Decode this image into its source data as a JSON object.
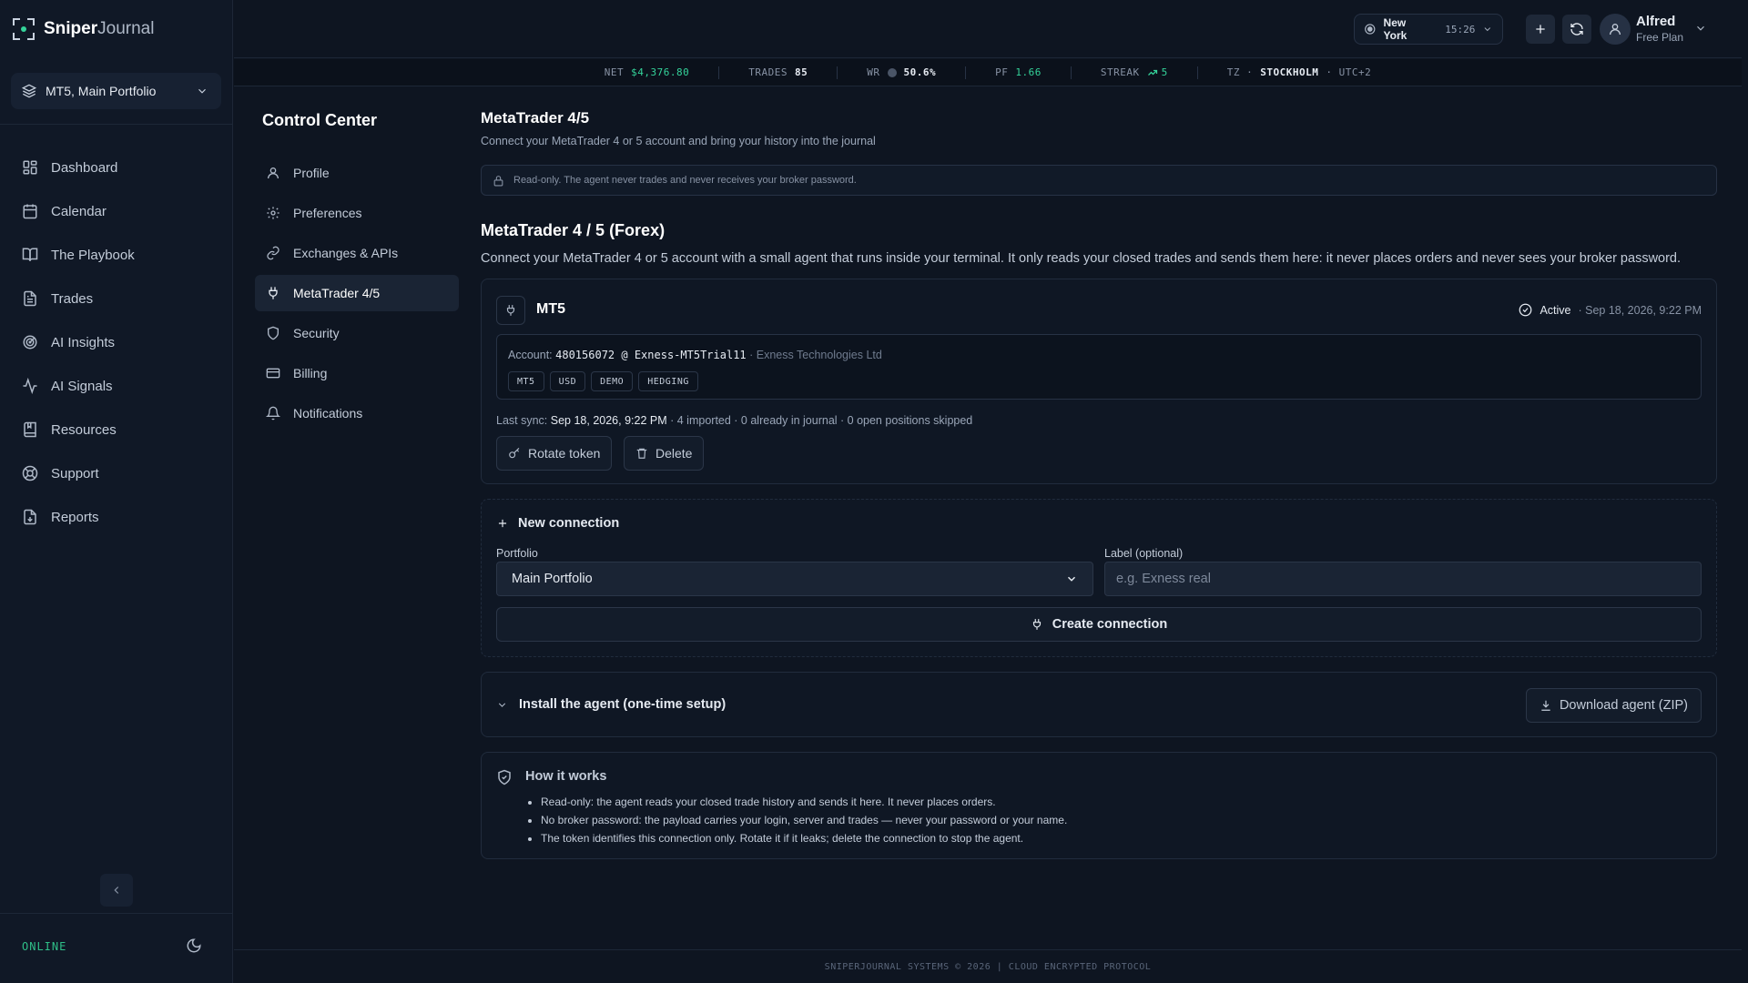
{
  "app": {
    "name_bold": "Sniper",
    "name_light": "Journal"
  },
  "sidebar": {
    "portfolio": "MT5, Main Portfolio",
    "items": [
      {
        "label": "Dashboard",
        "icon": "grid-icon"
      },
      {
        "label": "Calendar",
        "icon": "calendar-icon"
      },
      {
        "label": "The Playbook",
        "icon": "book-icon"
      },
      {
        "label": "Trades",
        "icon": "document-icon"
      },
      {
        "label": "AI Insights",
        "icon": "radar-icon"
      },
      {
        "label": "AI Signals",
        "icon": "pulse-icon"
      },
      {
        "label": "Resources",
        "icon": "bookmark-book-icon"
      },
      {
        "label": "Support",
        "icon": "lifebuoy-icon"
      },
      {
        "label": "Reports",
        "icon": "file-download-icon"
      }
    ],
    "status": "ONLINE"
  },
  "topbar": {
    "city": "New York",
    "time": "15:26",
    "user": {
      "name": "Alfred",
      "plan": "Free Plan"
    }
  },
  "stats": {
    "net_label": "NET",
    "net_value": "$4,376.80",
    "trades_label": "TRADES",
    "trades_value": "85",
    "wr_label": "WR",
    "wr_value": "50.6%",
    "pf_label": "PF",
    "pf_value": "1.66",
    "streak_label": "STREAK",
    "streak_value": "5",
    "tz_label": "TZ ·",
    "tz_city": "STOCKHOLM",
    "tz_offset": "· UTC+2"
  },
  "control_center": {
    "title": "Control Center",
    "items": [
      {
        "label": "Profile"
      },
      {
        "label": "Preferences"
      },
      {
        "label": "Exchanges & APIs"
      },
      {
        "label": "MetaTrader 4/5"
      },
      {
        "label": "Security"
      },
      {
        "label": "Billing"
      },
      {
        "label": "Notifications"
      }
    ]
  },
  "page": {
    "title": "MetaTrader 4/5",
    "subtitle": "Connect your MetaTrader 4 or 5 account and bring your history into the journal",
    "notice": "Read-only. The agent never trades and never receives your broker password.",
    "section_title": "MetaTrader 4 / 5 (Forex)",
    "section_desc": "Connect your MetaTrader 4 or 5 account with a small agent that runs inside your terminal. It only reads your closed trades and sends them here: it never places orders and never sees your broker password."
  },
  "connection": {
    "name": "MT5",
    "status": "Active",
    "status_time": "· Sep 18, 2026, 9:22 PM",
    "account_label": "Account:",
    "account_value": "480156072 @ Exness-MT5Trial11",
    "broker": "· Exness Technologies Ltd",
    "tags": [
      "MT5",
      "USD",
      "DEMO",
      "HEDGING"
    ],
    "last_sync_label": "Last sync:",
    "last_sync_value": "Sep 18, 2026, 9:22 PM",
    "sync_details": "· 4 imported · 0 already in journal · 0 open positions skipped",
    "rotate_label": "Rotate token",
    "delete_label": "Delete"
  },
  "new_connection": {
    "title": "New connection",
    "portfolio_label": "Portfolio",
    "portfolio_value": "Main Portfolio",
    "label_label": "Label (optional)",
    "label_placeholder": "e.g. Exness real",
    "create_label": "Create connection"
  },
  "install": {
    "title": "Install the agent (one-time setup)",
    "download_label": "Download agent (ZIP)"
  },
  "how": {
    "title": "How it works",
    "points": [
      "Read-only: the agent reads your closed trade history and sends it here. It never places orders.",
      "No broker password: the payload carries your login, server and trades — never your password or your name.",
      "The token identifies this connection only. Rotate it if it leaks; delete the connection to stop the agent."
    ]
  },
  "footer": "SNIPERJOURNAL SYSTEMS © 2026 | CLOUD ENCRYPTED PROTOCOL",
  "colors": {
    "accent_green": "#34d39a",
    "background": "#0e1521",
    "panel": "#101826"
  }
}
